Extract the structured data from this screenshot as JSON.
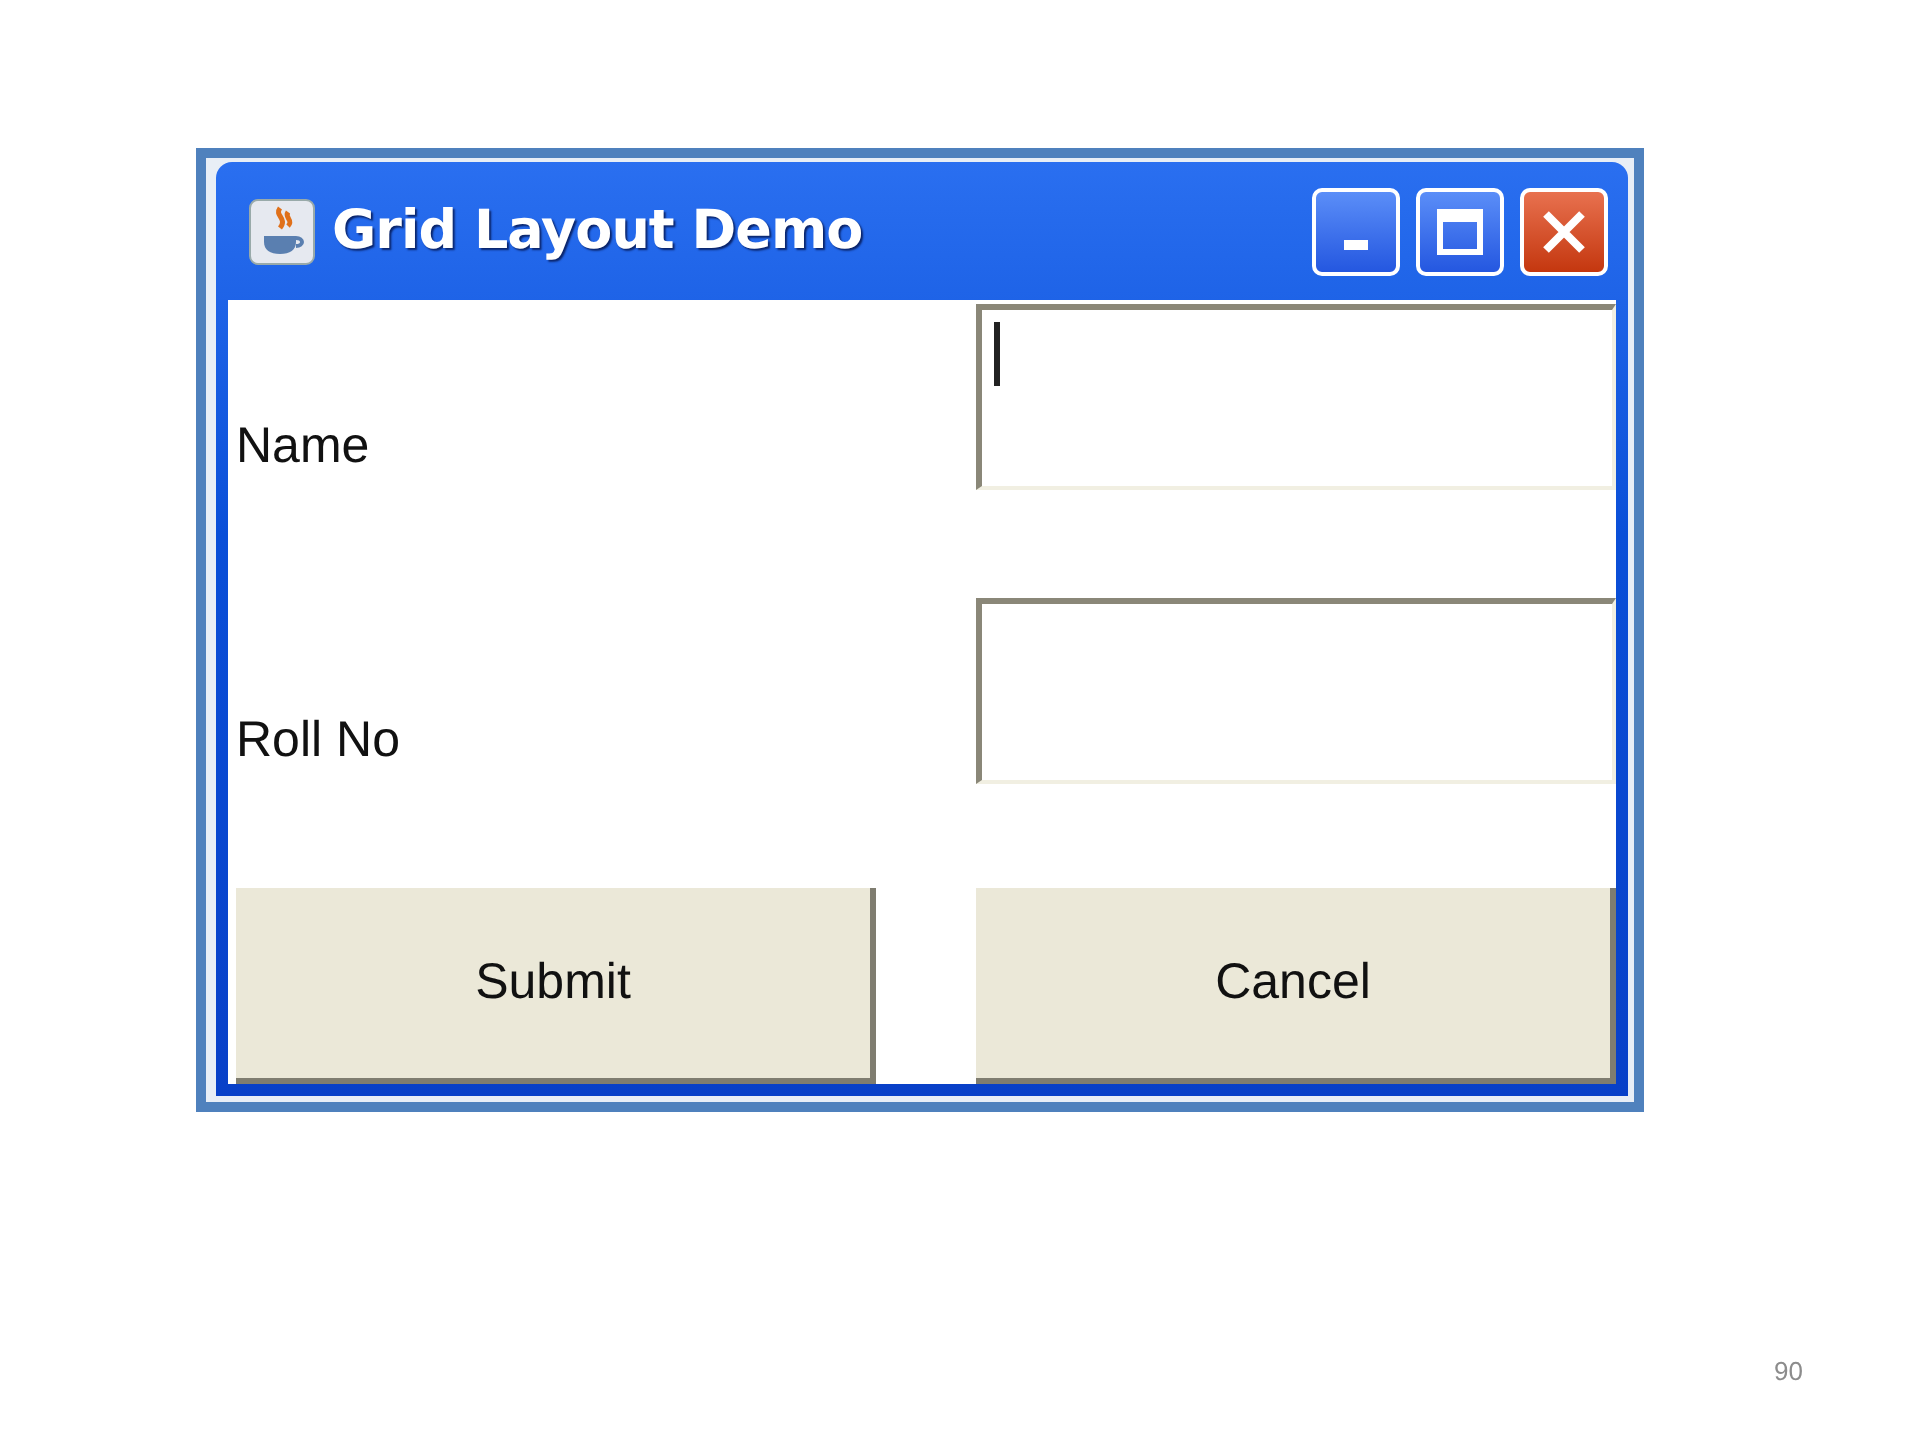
{
  "window": {
    "title": "Grid Layout Demo"
  },
  "rows": [
    {
      "label": "Name",
      "field": {
        "focused": true
      }
    },
    {
      "label": "Roll No",
      "field": {
        "focused": false
      }
    }
  ],
  "buttons": [
    "Submit",
    "Cancel"
  ],
  "slide_number": "90"
}
